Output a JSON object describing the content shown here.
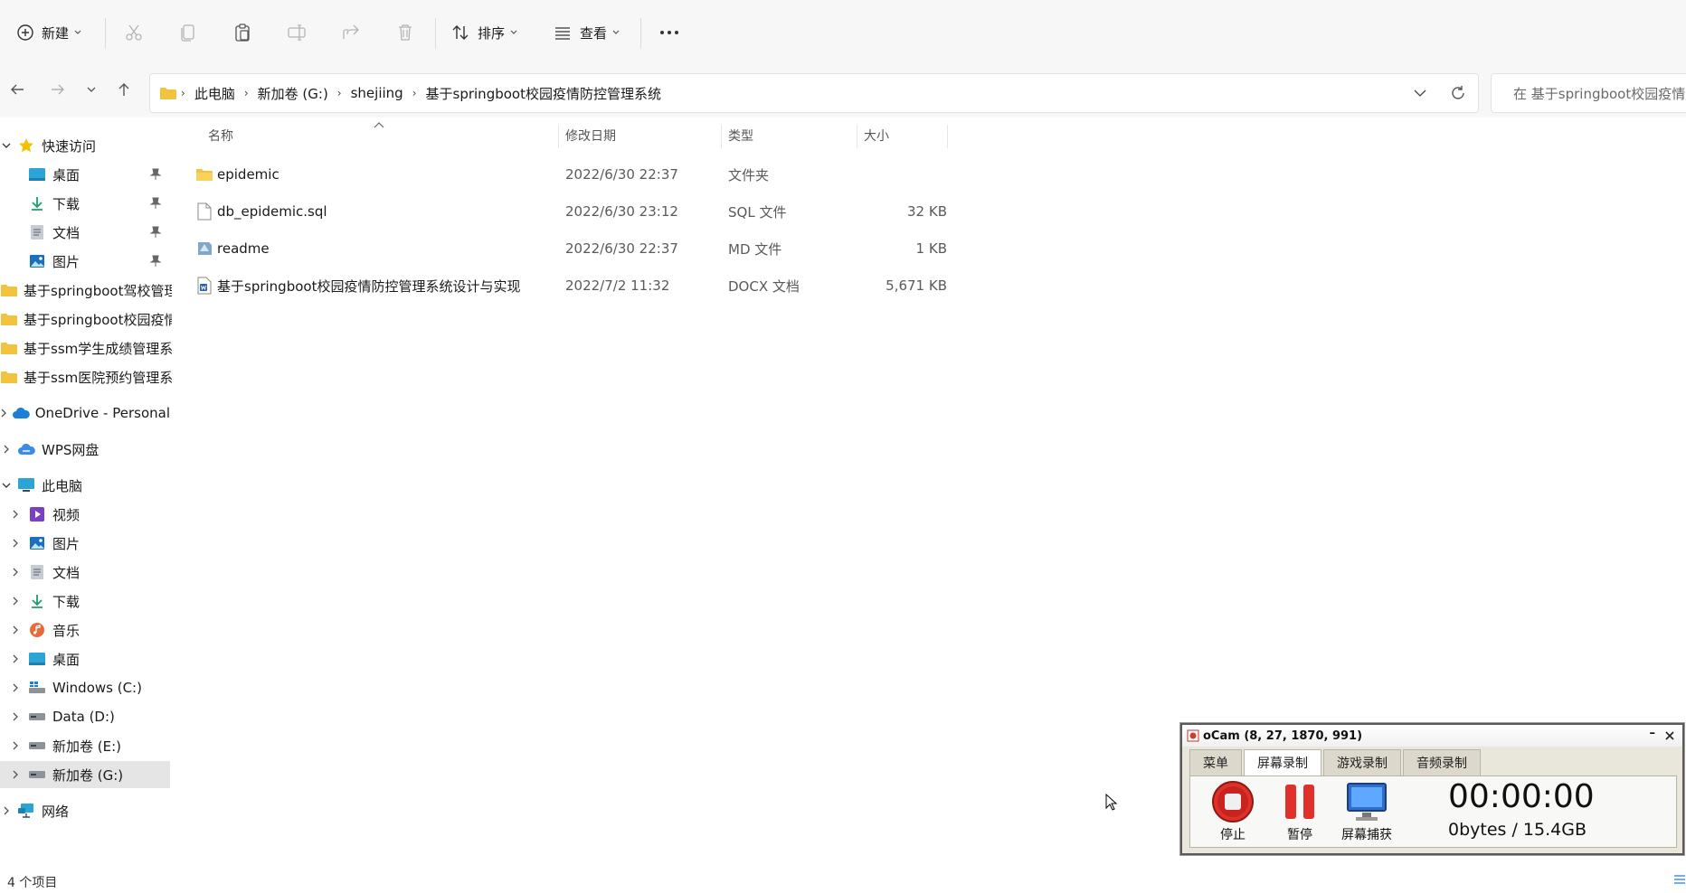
{
  "toolbar": {
    "new_label": "新建",
    "sort_label": "排序",
    "view_label": "查看"
  },
  "address": {
    "crumbs": [
      "此电脑",
      "新加卷 (G:)",
      "shejiing",
      "基于springboot校园疫情防控管理系统"
    ]
  },
  "search": {
    "placeholder": "在 基于springboot校园疫情防控管理系统 中搜索"
  },
  "sidebar": {
    "quick_access": "快速访问",
    "quick_items": [
      {
        "label": "桌面",
        "icon": "desktop-icon"
      },
      {
        "label": "下载",
        "icon": "download-icon"
      },
      {
        "label": "文档",
        "icon": "document-icon"
      },
      {
        "label": "图片",
        "icon": "picture-icon"
      },
      {
        "label": "基于springboot驾校管理系统",
        "icon": "folder-icon"
      },
      {
        "label": "基于springboot校园疫情防控管理系统",
        "icon": "folder-icon"
      },
      {
        "label": "基于ssm学生成绩管理系统",
        "icon": "folder-icon"
      },
      {
        "label": "基于ssm医院预约管理系统",
        "icon": "folder-icon"
      }
    ],
    "onedrive": "OneDrive - Personal",
    "wps": "WPS网盘",
    "this_pc": "此电脑",
    "pc_items": [
      {
        "label": "视频",
        "icon": "video-icon"
      },
      {
        "label": "图片",
        "icon": "picture-icon"
      },
      {
        "label": "文档",
        "icon": "document-icon"
      },
      {
        "label": "下载",
        "icon": "download-icon"
      },
      {
        "label": "音乐",
        "icon": "music-icon"
      },
      {
        "label": "桌面",
        "icon": "desktop-icon"
      },
      {
        "label": "Windows (C:)",
        "icon": "drive-icon"
      },
      {
        "label": "Data (D:)",
        "icon": "drive-icon"
      },
      {
        "label": "新加卷 (E:)",
        "icon": "drive-icon"
      },
      {
        "label": "新加卷 (G:)",
        "icon": "drive-icon"
      }
    ],
    "network": "网络"
  },
  "columns": {
    "name": "名称",
    "modified": "修改日期",
    "type": "类型",
    "size": "大小"
  },
  "files": [
    {
      "name": "epidemic",
      "modified": "2022/6/30 22:37",
      "type": "文件夹",
      "size": "",
      "icon": "folder-icon"
    },
    {
      "name": "db_epidemic.sql",
      "modified": "2022/6/30 23:12",
      "type": "SQL 文件",
      "size": "32 KB",
      "icon": "file-icon"
    },
    {
      "name": "readme",
      "modified": "2022/6/30 22:37",
      "type": "MD 文件",
      "size": "1 KB",
      "icon": "markdown-icon"
    },
    {
      "name": "基于springboot校园疫情防控管理系统设计与实现",
      "modified": "2022/7/2 11:32",
      "type": "DOCX 文档",
      "size": "5,671 KB",
      "icon": "word-doc-icon"
    }
  ],
  "status": {
    "count": "4 个项目"
  },
  "ocam": {
    "title": "oCam (8, 27, 1870, 991)",
    "tabs": [
      "菜单",
      "屏幕录制",
      "游戏录制",
      "音频录制"
    ],
    "active_tab": "屏幕录制",
    "stop_label": "停止",
    "pause_label": "暂停",
    "capture_label": "屏幕捕获",
    "timer": "00:00:00",
    "bytes": "0bytes / 15.4GB"
  },
  "colors": {
    "folder": "#f4c33d",
    "selection": "#e5e5e5",
    "accent": "#0067c0"
  }
}
